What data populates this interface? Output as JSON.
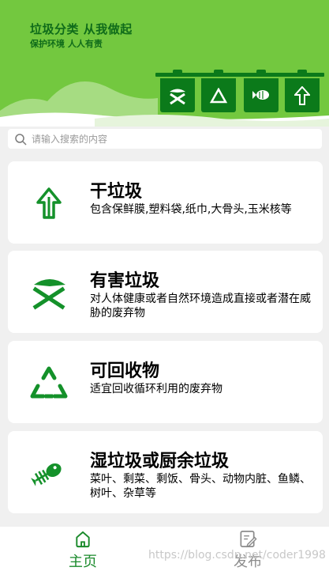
{
  "header": {
    "title": "垃圾分类 从我做起",
    "subtitle": "保护环境 人人有责",
    "bins": [
      {
        "icon": "hazardous-bin-icon"
      },
      {
        "icon": "recyclable-bin-icon"
      },
      {
        "icon": "kitchen-bin-icon"
      },
      {
        "icon": "residual-bin-icon"
      }
    ]
  },
  "search": {
    "placeholder": "请输入搜索的内容",
    "icon": "search-icon"
  },
  "categories": [
    {
      "title": "干垃圾",
      "desc": "包含保鲜膜,塑料袋,纸巾,大骨头,玉米核等",
      "icon": "residual-waste-icon"
    },
    {
      "title": "有害垃圾",
      "desc": "对人体健康或者自然环境造成直接或者潜在威胁的废弃物",
      "icon": "hazardous-waste-icon"
    },
    {
      "title": "可回收物",
      "desc": "适宜回收循环利用的废弃物",
      "icon": "recyclable-icon"
    },
    {
      "title": "湿垃圾或厨余垃圾",
      "desc": "菜叶、剩菜、剩饭、骨头、动物内脏、鱼鳞、树叶、杂草等",
      "icon": "fish-bone-icon"
    }
  ],
  "tabbar": {
    "home_label": "主页",
    "publish_label": "发布"
  },
  "watermark": "https://blog.csdn.net/coder1998",
  "colors": {
    "header_bg": "#73c83f",
    "hill_light": "#a6dc82",
    "brand_dark": "#0b7a1a",
    "icon_green": "#14912a",
    "tab_active": "#1a8a2b",
    "tab_inactive": "#8c8c8c"
  }
}
